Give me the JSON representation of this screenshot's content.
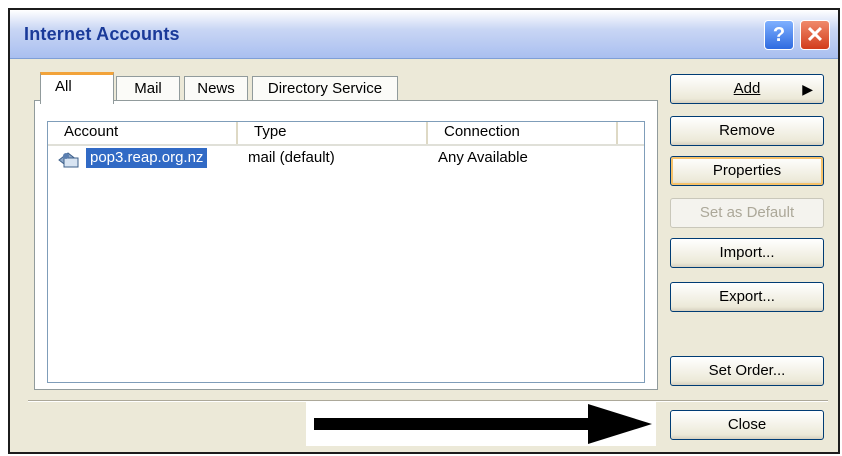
{
  "window": {
    "title": "Internet Accounts"
  },
  "titlebar": {
    "help_glyph": "?",
    "close_glyph": "✕"
  },
  "tabs": [
    {
      "label": "All"
    },
    {
      "label": "Mail"
    },
    {
      "label": "News"
    },
    {
      "label": "Directory Service"
    }
  ],
  "list": {
    "columns": [
      "Account",
      "Type",
      "Connection"
    ],
    "rows": [
      {
        "account": "pop3.reap.org.nz",
        "type": "mail (default)",
        "connection": "Any Available",
        "icon": "mail-account-icon"
      }
    ]
  },
  "buttons": {
    "add": "Add",
    "add_arrow": "▶",
    "remove": "Remove",
    "properties": "Properties",
    "set_default": "Set as Default",
    "import": "Import...",
    "export": "Export...",
    "set_order": "Set Order...",
    "close": "Close"
  },
  "colors": {
    "title_text": "#1a3a99",
    "selection": "#316ac5",
    "active_tab_accent": "#f2a33a",
    "arrow": "#000000"
  }
}
